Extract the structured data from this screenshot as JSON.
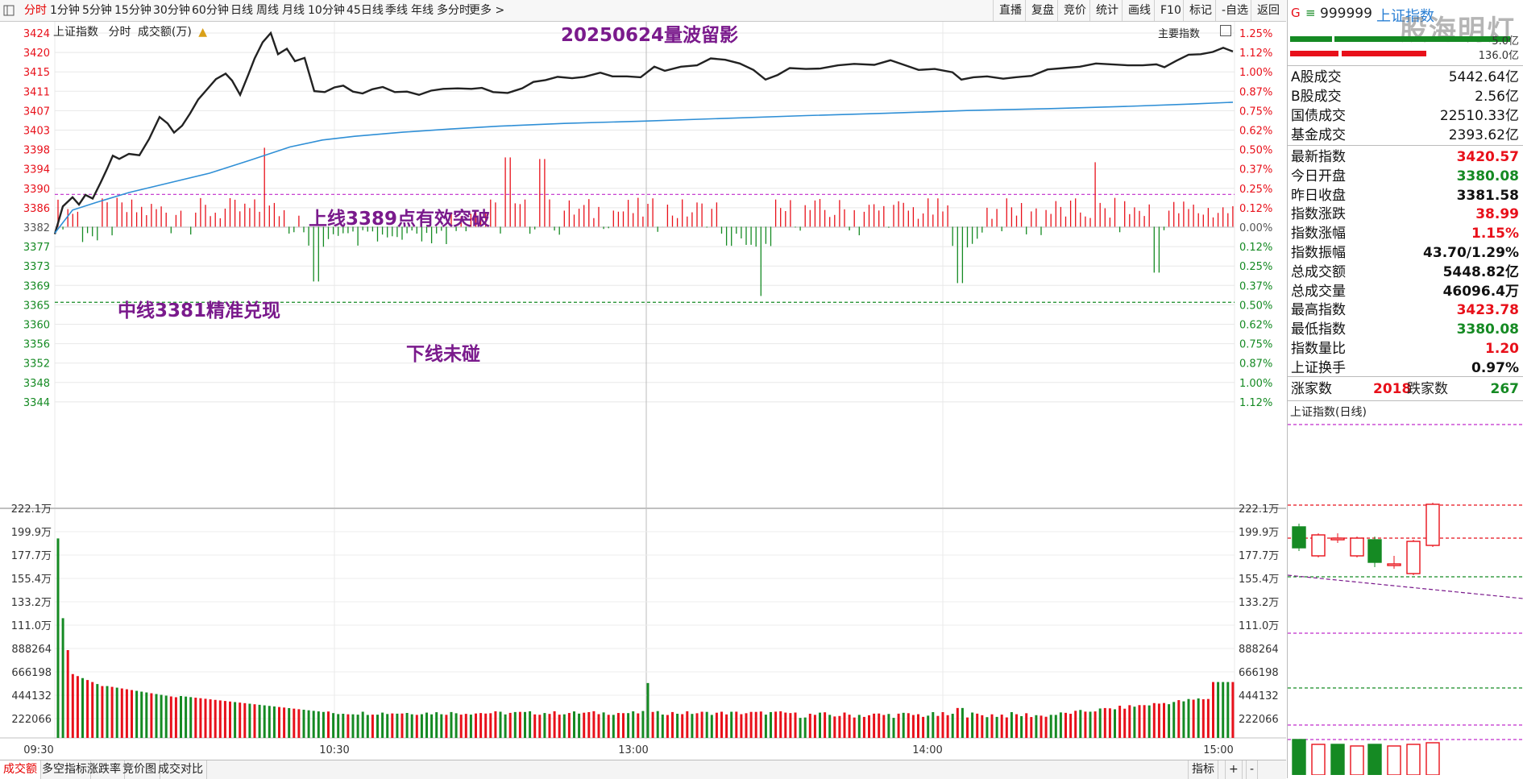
{
  "toolbar": {
    "menu_icon": "menu-icon",
    "periods": [
      "分时",
      "1分钟",
      "5分钟",
      "15分钟",
      "30分钟",
      "60分钟",
      "日线",
      "周线",
      "月线",
      "10分钟",
      "45日线",
      "季线",
      "年线",
      "多分时",
      "更多 >"
    ],
    "active": "分时",
    "right_buttons": [
      "直播",
      "复盘",
      "竞价",
      "统计",
      "画线",
      "F10",
      "标记",
      "-自选",
      "返回"
    ]
  },
  "chart_header": {
    "index_name": "上证指数",
    "mode": "分时",
    "volume_label": "成交额(万)",
    "title": "20250624量波留影",
    "main_index_btn": "主要指数"
  },
  "annotations": {
    "upper": "上线3389点有效突破",
    "middle": "中线3381精准兑现",
    "lower": "下线未碰"
  },
  "price_axis": {
    "left": [
      "3424",
      "3420",
      "3415",
      "3411",
      "3407",
      "3403",
      "3398",
      "3394",
      "3390",
      "3386",
      "3382",
      "3377",
      "3373",
      "3369",
      "3365",
      "3360",
      "3356",
      "3352",
      "3348",
      "3344"
    ],
    "right": [
      "1.25%",
      "1.12%",
      "1.00%",
      "0.87%",
      "0.75%",
      "0.62%",
      "0.50%",
      "0.37%",
      "0.25%",
      "0.12%",
      "0.00%",
      "0.12%",
      "0.25%",
      "0.37%",
      "0.50%",
      "0.62%",
      "0.75%",
      "0.87%",
      "1.00%",
      "1.12%"
    ]
  },
  "volume_axis": [
    "222.1万",
    "199.9万",
    "177.7万",
    "155.4万",
    "133.2万",
    "111.0万",
    "888264",
    "666198",
    "444132",
    "222066"
  ],
  "time_axis": [
    "09:30",
    "10:30",
    "13:00",
    "14:00",
    "15:00"
  ],
  "colors": {
    "up": "#e8101a",
    "down": "#158a23",
    "price_line": "#222222",
    "avg_line": "#2f8fd6",
    "upper_line": "#c02ccc",
    "lower_line": "#158a23"
  },
  "bottom_tabs": [
    "成交额",
    "多空指标",
    "涨跌率",
    "竞价图",
    "成交对比"
  ],
  "bottom_right": [
    "指标",
    "+",
    "-"
  ],
  "right_panel": {
    "code_badge": "G",
    "code": "999999",
    "name": "上证指数",
    "watermark": "股海明灯",
    "bar_values": [
      "5.0亿",
      "136.0亿"
    ],
    "stats_a": [
      {
        "label": "A股成交",
        "value": "5442.64亿"
      },
      {
        "label": "B股成交",
        "value": "2.56亿"
      },
      {
        "label": "国债成交",
        "value": "22510.33亿"
      },
      {
        "label": "基金成交",
        "value": "2393.62亿"
      }
    ],
    "stats_b": [
      {
        "label": "最新指数",
        "value": "3420.57",
        "color": "red"
      },
      {
        "label": "今日开盘",
        "value": "3380.08",
        "color": "green"
      },
      {
        "label": "昨日收盘",
        "value": "3381.58",
        "color": "dark"
      },
      {
        "label": "指数涨跌",
        "value": "38.99",
        "color": "red"
      },
      {
        "label": "指数涨幅",
        "value": "1.15%",
        "color": "red"
      },
      {
        "label": "指数振幅",
        "value": "43.70/1.29%",
        "color": "dark"
      },
      {
        "label": "总成交额",
        "value": "5448.82亿",
        "color": "dark"
      },
      {
        "label": "总成交量",
        "value": "46096.4万",
        "color": "dark"
      },
      {
        "label": "最高指数",
        "value": "3423.78",
        "color": "red"
      },
      {
        "label": "最低指数",
        "value": "3380.08",
        "color": "green"
      },
      {
        "label": "指数量比",
        "value": "1.20",
        "color": "red"
      },
      {
        "label": "上证换手",
        "value": "0.97%",
        "color": "dark"
      }
    ],
    "up_label": "涨家数",
    "up_count": "2018",
    "down_label": "跌家数",
    "down_count": "267",
    "mini_title": "上证指数(日线)"
  }
}
